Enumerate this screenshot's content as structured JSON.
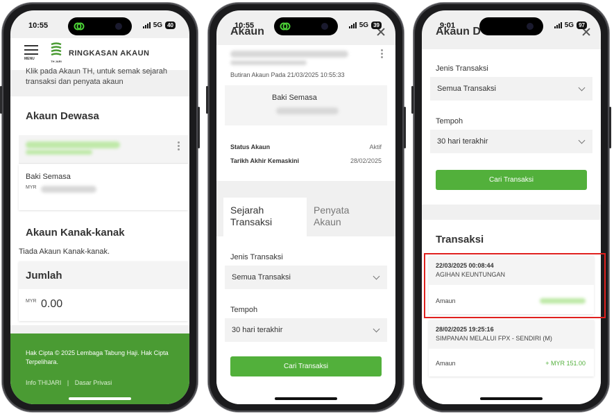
{
  "phone1": {
    "status_time": "10:55",
    "network": "5G",
    "battery": "40",
    "header_title": "RINGKASAN AKAUN",
    "menu_label": "MENU",
    "logo_label": "TH JARI",
    "intro_text": "Klik pada Akaun TH, untuk semak sejarah transaksi dan penyata akaun",
    "adult_heading": "Akaun Dewasa",
    "current_balance_label": "Baki Semasa",
    "currency": "MYR",
    "child_heading": "Akaun Kanak-kanak",
    "no_child_text": "Tiada Akaun Kanak-kanak.",
    "total_heading": "Jumlah",
    "total_currency": "MYR",
    "total_value": "0.00",
    "footer_copyright": "Hak Cipta © 2025 Lembaga Tabung Haji. Hak Cipta Terpelihara.",
    "footer_link_info": "Info THIJARI",
    "footer_link_privacy": "Dasar Privasi"
  },
  "phone2": {
    "status_time": "10:55",
    "network": "5G",
    "battery": "39",
    "header_title": "Akaun",
    "details_timestamp": "Butiran Akaun Pada 21/03/2025 10:55:33",
    "current_balance_label": "Baki Semasa",
    "status_label": "Status Akaun",
    "status_value": "Aktif",
    "updated_label": "Tarikh Akhir Kemaskini",
    "updated_value": "28/02/2025",
    "tab_history": "Sejarah Transaksi",
    "tab_statement": "Penyata Akaun",
    "type_label": "Jenis Transaksi",
    "type_value": "Semua Transaksi",
    "period_label": "Tempoh",
    "period_value": "30 hari terakhir",
    "search_button": "Cari Transaksi"
  },
  "phone3": {
    "status_time": "9:01",
    "network": "5G",
    "battery": "97",
    "header_title": "Akaun D",
    "type_label": "Jenis Transaksi",
    "type_value": "Semua Transaksi",
    "period_label": "Tempoh",
    "period_value": "30 hari terakhir",
    "search_button": "Cari Transaksi",
    "transactions_heading": "Transaksi",
    "transactions": [
      {
        "datetime": "22/03/2025 00:08:44",
        "description": "AGIHAN KEUNTUNGAN",
        "amount_label": "Amaun",
        "amount": ""
      },
      {
        "datetime": "28/02/2025 19:25:16",
        "description": "SIMPANAN MELALUI FPX - SENDIRI (M)",
        "amount_label": "Amaun",
        "amount": "+ MYR 151.00"
      }
    ]
  },
  "colors": {
    "brand_green": "#52b03b",
    "footer_green": "#4a9b33",
    "highlight_red": "#e0201e",
    "amount_green": "#52b03b"
  }
}
